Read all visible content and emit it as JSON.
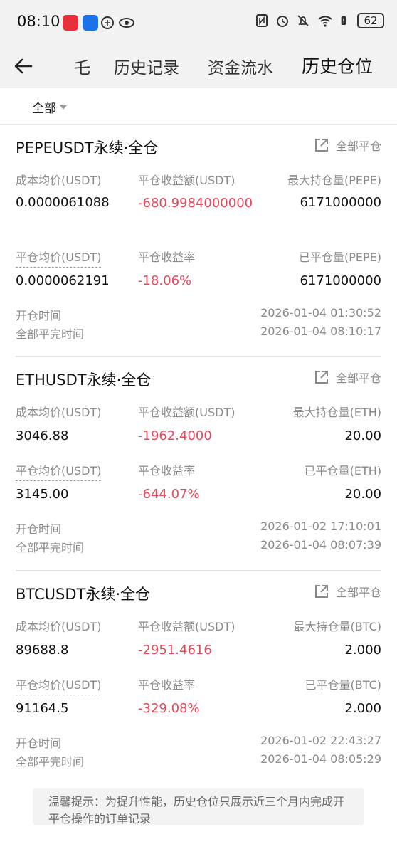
{
  "status": {
    "time": "08:10",
    "battery": "62",
    "icons": [
      "news-app-icon",
      "hand-app-icon",
      "wechat-like-icon",
      "eye-icon",
      "nfc-icon",
      "alarm-icon",
      "mute-icon",
      "wifi-6-icon",
      "battery-alert-icon"
    ],
    "app_colors": [
      "#e8303d",
      "#1a73e8"
    ]
  },
  "nav": {
    "partial_tab": "乇",
    "tabs": [
      "历史记录",
      "资金流水",
      "历史仓位"
    ]
  },
  "filter": {
    "label": "全部"
  },
  "close_all_label": "全部平仓",
  "labels": {
    "avg_cost": "成本均价(USDT)",
    "close_pnl": "平仓收益额(USDT)",
    "close_avg": "平仓均价(USDT)",
    "close_rate": "平仓收益率",
    "open_time": "开仓时间",
    "close_time": "全部平完时间"
  },
  "positions": [
    {
      "title": "PEPEUSDT永续·全仓",
      "max_pos_label": "最大持仓量(PEPE)",
      "closed_label": "已平仓量(PEPE)",
      "avg_cost": "0.0000061088",
      "pnl": "-680.9984000000",
      "max_pos": "6171000000",
      "close_avg": "0.0000062191",
      "rate": "-18.06%",
      "closed": "6171000000",
      "open_time": "2026-01-04 01:30:52",
      "close_time": "2026-01-04 08:10:17"
    },
    {
      "title": "ETHUSDT永续·全仓",
      "max_pos_label": "最大持仓量(ETH)",
      "closed_label": "已平仓量(ETH)",
      "avg_cost": "3046.88",
      "pnl": "-1962.4000",
      "max_pos": "20.00",
      "close_avg": "3145.00",
      "rate": "-644.07%",
      "closed": "20.00",
      "open_time": "2026-01-02 17:10:01",
      "close_time": "2026-01-04 08:07:39"
    },
    {
      "title": "BTCUSDT永续·全仓",
      "max_pos_label": "最大持仓量(BTC)",
      "closed_label": "已平仓量(BTC)",
      "avg_cost": "89688.8",
      "pnl": "-2951.4616",
      "max_pos": "2.000",
      "close_avg": "91164.5",
      "rate": "-329.08%",
      "closed": "2.000",
      "open_time": "2026-01-02 22:43:27",
      "close_time": "2026-01-04 08:05:29"
    }
  ],
  "tip": "温馨提示：为提升性能，历史仓位只展示近三个月内完成开平仓操作的订单记录",
  "colors": {
    "negative": "#e8475b",
    "muted": "#8a8a8a",
    "bar_bg": "#f2f2f2"
  }
}
